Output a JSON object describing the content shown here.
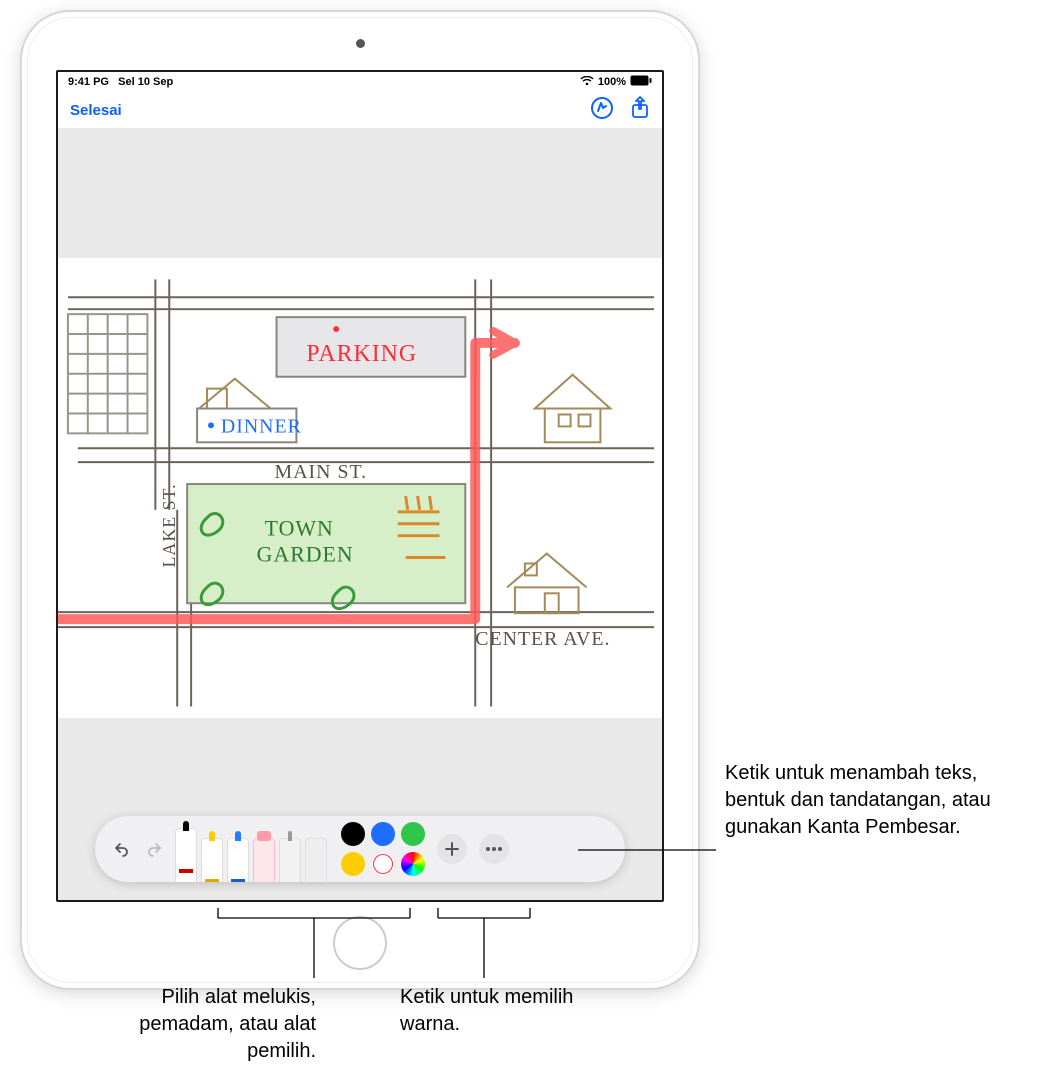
{
  "status": {
    "time": "9:41 PG",
    "date": "Sel 10 Sep",
    "battery": "100%"
  },
  "nav": {
    "done": "Selesai"
  },
  "drawing": {
    "parking": "PARKING",
    "dinner": "DINNER",
    "main_st": "MAIN ST.",
    "town_garden_1": "TOWN",
    "town_garden_2": "GARDEN",
    "lake_st": "LAKE ST.",
    "center_ave": "CENTER AVE."
  },
  "toolbar": {
    "tools": [
      "undo",
      "redo",
      "pen",
      "marker",
      "pencil",
      "eraser",
      "lasso",
      "ruler"
    ],
    "colors": {
      "black": "#000000",
      "blue": "#1e6dff",
      "green": "#2fc64a",
      "yellow": "#ffcc00",
      "red": "#ff2d3a"
    }
  },
  "callouts": {
    "add": "Ketik untuk menambah teks, bentuk dan tandatangan, atau gunakan Kanta Pembesar.",
    "tools": "Pilih alat melukis, pemadam, atau alat pemilih.",
    "colors": "Ketik untuk memilih warna."
  }
}
